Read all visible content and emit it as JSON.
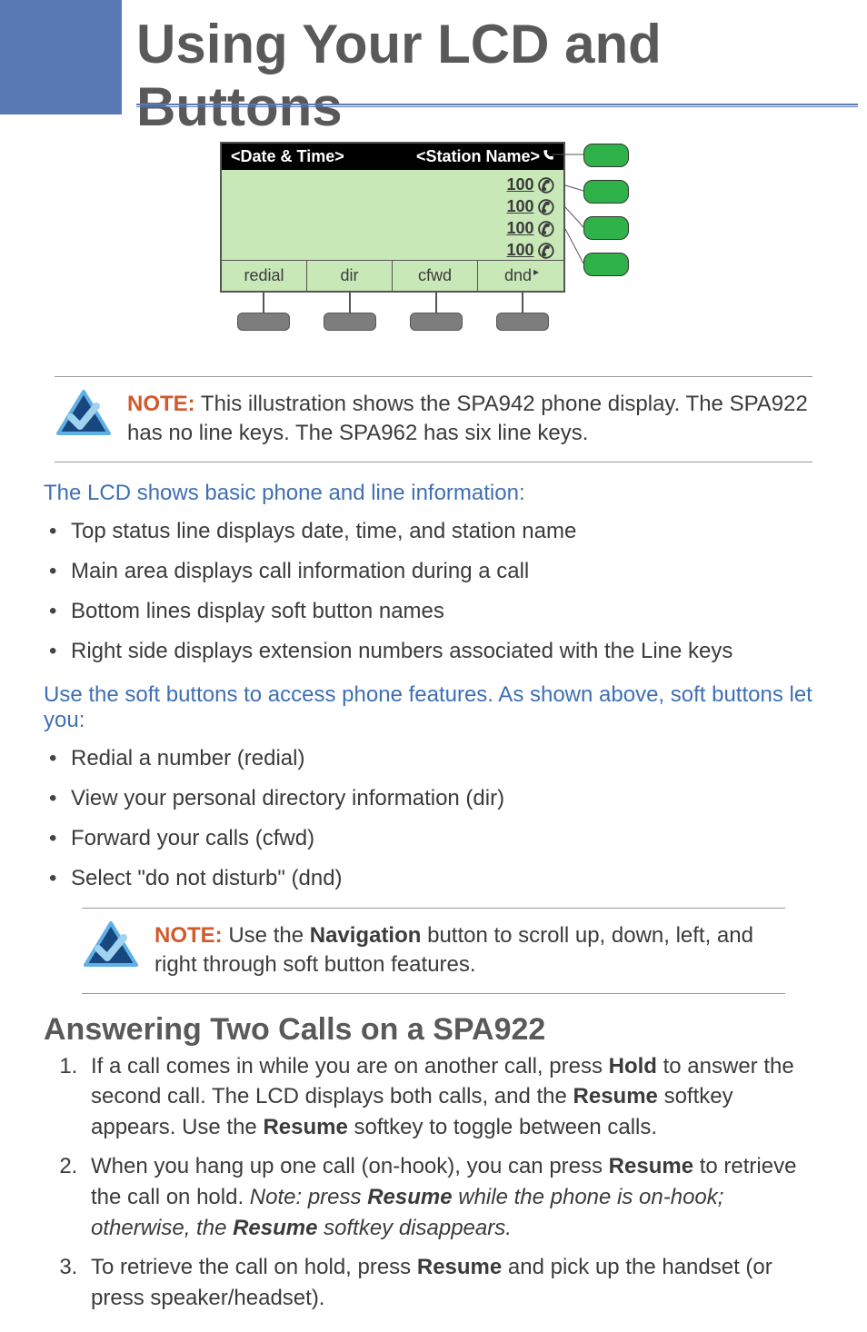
{
  "banner": {
    "title": "Using Your LCD and  Buttons"
  },
  "lcd": {
    "top_left": "<Date & Time>",
    "top_right": "<Station Name>",
    "extensions": [
      "100",
      "100",
      "100",
      "100"
    ],
    "softkeys": [
      "redial",
      "dir",
      "cfwd",
      "dnd"
    ]
  },
  "note1": {
    "label": "NOTE:",
    "text": "This illustration shows the SPA942 phone display. The SPA922 has no line keys. The SPA962 has six line keys."
  },
  "section_a": {
    "heading": "The LCD shows basic phone and line information:",
    "bullets": [
      "Top status line displays date, time, and station name",
      "Main area displays call information during a call",
      "Bottom lines display soft button names",
      "Right side displays extension numbers associated with the Line keys"
    ]
  },
  "section_b": {
    "heading": "Use the soft buttons to access phone features. As shown above, soft buttons let you:",
    "bullets": [
      "Redial a number (redial)",
      "View your personal directory information (dir)",
      " Forward your calls (cfwd)",
      "Select \"do not disturb\" (dnd)"
    ]
  },
  "note2": {
    "label": "NOTE:",
    "pre": "Use the ",
    "bold": "Navigation",
    "post": " button to scroll up, down, left, and right through soft button features."
  },
  "answering": {
    "heading": "Answering Two Calls on a SPA922",
    "steps": {
      "s1a": "If a call comes in while you are on another call, press ",
      "s1b": "Hold",
      "s1c": " to answer the second call.  The LCD displays both calls, and the ",
      "s1d": "Resume",
      "s1e": " softkey appears. Use  the ",
      "s1f": "Resume",
      "s1g": " softkey to toggle between calls.",
      "s2a": "When you hang up one call (on-hook), you can press ",
      "s2b": "Resume",
      "s2c": " to retrieve the call on hold.  ",
      "s2d": "Note: press ",
      "s2e": "Resume",
      "s2f": " while the phone is on-hook; otherwise, the ",
      "s2g": "Resume",
      "s2h": " softkey disappears.",
      "s3a": "To retrieve the call on hold, press ",
      "s3b": "Resume",
      "s3c": " and pick up the handset (or press speaker/headset)."
    }
  }
}
